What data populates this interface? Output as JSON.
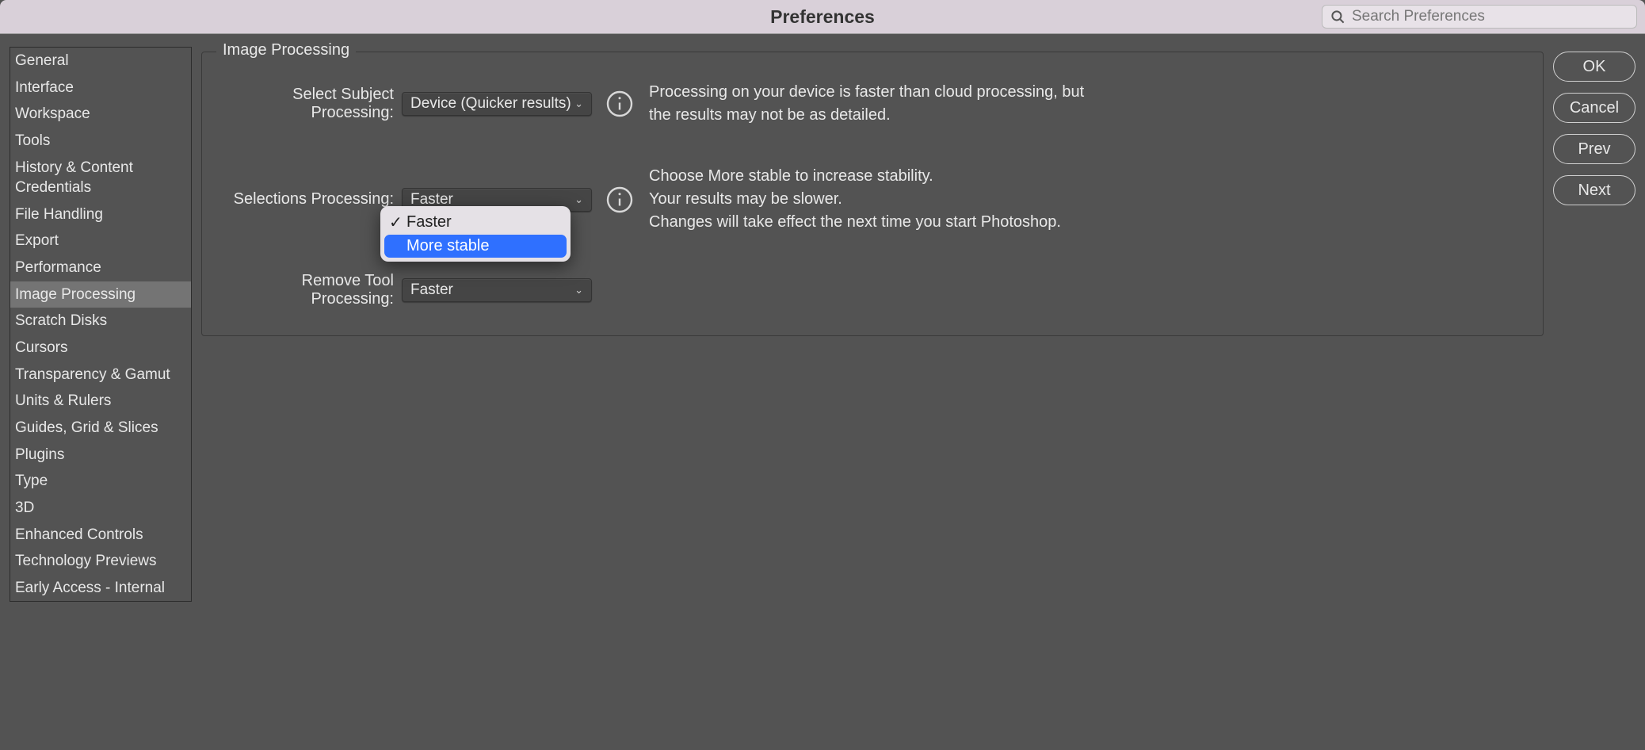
{
  "window": {
    "title": "Preferences"
  },
  "search": {
    "placeholder": "Search Preferences",
    "value": ""
  },
  "sidebar": {
    "items": [
      {
        "label": "General"
      },
      {
        "label": "Interface"
      },
      {
        "label": "Workspace"
      },
      {
        "label": "Tools"
      },
      {
        "label": "History & Content Credentials"
      },
      {
        "label": "File Handling"
      },
      {
        "label": "Export"
      },
      {
        "label": "Performance"
      },
      {
        "label": "Image Processing",
        "selected": true
      },
      {
        "label": "Scratch Disks"
      },
      {
        "label": "Cursors"
      },
      {
        "label": "Transparency & Gamut"
      },
      {
        "label": "Units & Rulers"
      },
      {
        "label": "Guides, Grid & Slices"
      },
      {
        "label": "Plugins"
      },
      {
        "label": "Type"
      },
      {
        "label": "3D"
      },
      {
        "label": "Enhanced Controls"
      },
      {
        "label": "Technology Previews"
      },
      {
        "label": "Early Access - Internal"
      }
    ]
  },
  "panel": {
    "title": "Image Processing",
    "rows": {
      "selectSubject": {
        "label": "Select Subject Processing:",
        "value": "Device (Quicker results)",
        "desc": "Processing on your device is faster than cloud processing, but the results may not be as detailed."
      },
      "selections": {
        "label": "Selections Processing:",
        "value": "Faster",
        "desc": "Choose More stable to increase stability.\nYour results may be slower.\nChanges will take effect the next time you start Photoshop."
      },
      "removeTool": {
        "label": "Remove Tool Processing:",
        "value": "Faster"
      }
    }
  },
  "dropdown": {
    "options": [
      {
        "label": "Faster",
        "checked": true
      },
      {
        "label": "More stable",
        "highlight": true
      }
    ]
  },
  "buttons": {
    "ok": "OK",
    "cancel": "Cancel",
    "prev": "Prev",
    "next": "Next"
  }
}
